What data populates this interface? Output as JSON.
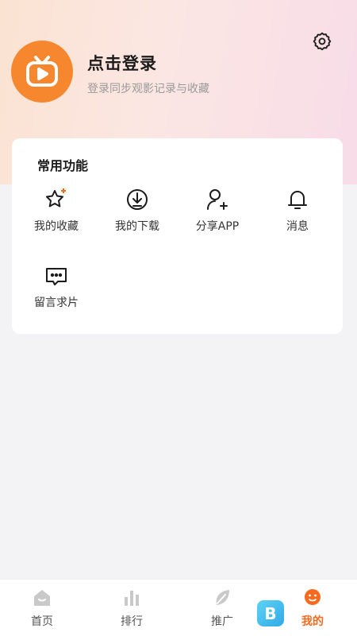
{
  "header": {
    "login_title": "点击登录",
    "login_subtitle": "登录同步观影记录与收藏"
  },
  "common": {
    "title": "常用功能",
    "items": [
      {
        "label": "我的收藏",
        "icon": "star-icon"
      },
      {
        "label": "我的下载",
        "icon": "download-icon"
      },
      {
        "label": "分享APP",
        "icon": "share-user-icon"
      },
      {
        "label": "消息",
        "icon": "bell-icon"
      },
      {
        "label": "留言求片",
        "icon": "message-icon"
      }
    ]
  },
  "tabbar": {
    "items": [
      {
        "label": "首页",
        "icon": "home-icon"
      },
      {
        "label": "排行",
        "icon": "ranking-icon"
      },
      {
        "label": "推广",
        "icon": "promote-icon"
      },
      {
        "label": "我的",
        "icon": "mine-icon",
        "active": true
      }
    ],
    "floating_badge": "B"
  },
  "colors": {
    "accent": "#f46a1e",
    "avatar": "#f7872e",
    "header_gradient_start": "#fbe3d2",
    "header_gradient_end": "#f8dce8"
  }
}
